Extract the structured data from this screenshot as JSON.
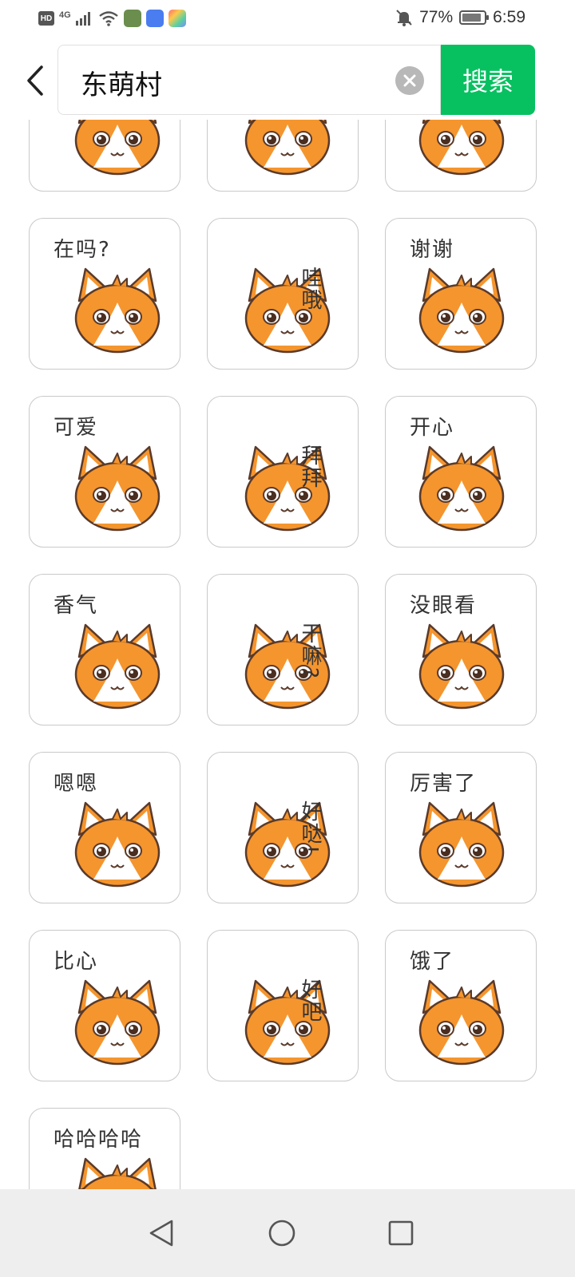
{
  "status_bar": {
    "hd": "HD",
    "network": "4G",
    "battery": "77%",
    "time": "6:59"
  },
  "search": {
    "query": "东萌村",
    "button": "搜索"
  },
  "stickers": [
    {
      "caption": ""
    },
    {
      "caption": ""
    },
    {
      "caption": ""
    },
    {
      "caption": "在吗?"
    },
    {
      "caption": "哇哦"
    },
    {
      "caption": "谢谢"
    },
    {
      "caption": "可爱"
    },
    {
      "caption": "拜拜"
    },
    {
      "caption": "开心"
    },
    {
      "caption": "香气"
    },
    {
      "caption": "干嘛?"
    },
    {
      "caption": "没眼看"
    },
    {
      "caption": "嗯嗯"
    },
    {
      "caption": "好哒!"
    },
    {
      "caption": "厉害了"
    },
    {
      "caption": "比心"
    },
    {
      "caption": "好吧"
    },
    {
      "caption": "饿了"
    },
    {
      "caption": "哈哈哈哈"
    }
  ],
  "icons": {
    "back": "back-arrow-icon",
    "clear": "clear-icon",
    "nav_back": "triangle-back-icon",
    "nav_home": "circle-home-icon",
    "nav_recents": "square-recents-icon"
  },
  "colors": {
    "accent": "#07c160",
    "cat_orange": "#f5952d",
    "outline": "#5a3a2a"
  }
}
